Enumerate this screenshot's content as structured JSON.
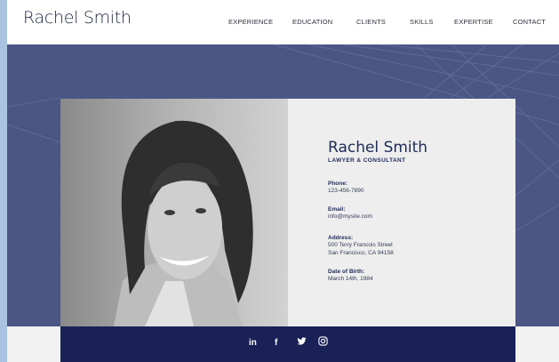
{
  "site": {
    "brand": "Rachel Smith"
  },
  "nav": {
    "items": [
      "EXPERIENCE",
      "EDUCATION",
      "CLIENTS",
      "SKILLS",
      "EXPERTISE",
      "CONTACT"
    ]
  },
  "profile": {
    "name": "Rachel Smith",
    "title": "LAWYER & CONSULTANT",
    "phone_label": "Phone:",
    "phone": "123-456-7890",
    "email_label": "Email:",
    "email": "info@mysite.com",
    "address_label": "Address:",
    "address_line1": "500 Terry Francois Street",
    "address_line2": "San Francisco, CA 94158",
    "dob_label": "Date of Birth:",
    "dob": "March 14th, 1984"
  },
  "social": {
    "icons": [
      "linkedin-icon",
      "facebook-icon",
      "twitter-icon",
      "instagram-icon"
    ]
  },
  "colors": {
    "hero": "#4b5684",
    "footer": "#1a2156",
    "accent": "#1f2b58"
  }
}
